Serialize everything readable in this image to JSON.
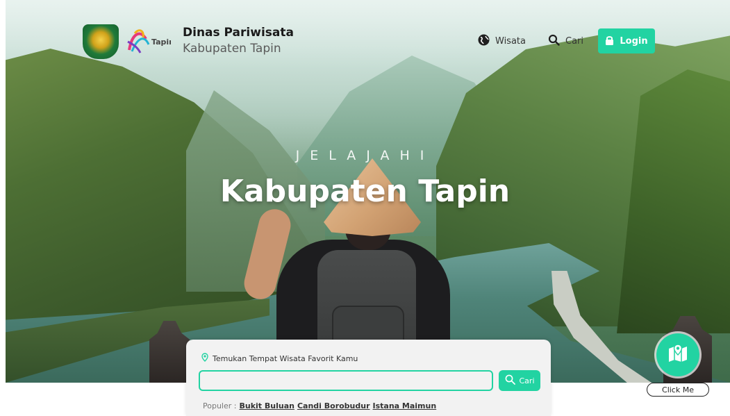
{
  "header": {
    "brand_title": "Dinas Pariwisata",
    "brand_subtitle": "Kabupaten Tapin",
    "tapin_logo_text": "Tapin",
    "nav": {
      "wisata_label": "Wisata",
      "cari_label": "Cari",
      "login_label": "Login"
    }
  },
  "hero": {
    "kicker": "JELAJAHI",
    "title": "Kabupaten Tapin"
  },
  "search": {
    "label": "Temukan Tempat Wisata Favorit Kamu",
    "input_value": "",
    "button_label": "Cari",
    "popular_prefix": "Populer :",
    "popular_links": [
      "Bukit Buluan",
      "Candi Borobudur",
      "Istana Maimun"
    ]
  },
  "fab": {
    "label": "Click Me"
  },
  "colors": {
    "accent": "#22d3a2",
    "title_text": "#1a1a1a",
    "subtitle_text": "#5a5a5a"
  },
  "icons": [
    "globe-icon",
    "search-icon",
    "lock-icon",
    "location-pin-icon",
    "map-location-icon"
  ]
}
